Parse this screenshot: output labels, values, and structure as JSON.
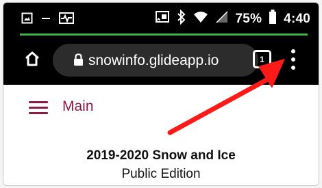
{
  "status_bar": {
    "battery_percent": "75%",
    "time": "4:40",
    "left_icons": [
      "gallery-icon",
      "minus-icon",
      "activity-icon"
    ],
    "right_icons": [
      "cast-icon",
      "bluetooth-icon",
      "wifi-icon",
      "signal-icon",
      "battery-icon"
    ]
  },
  "browser": {
    "url": "snowinfo.glideapp.io",
    "tab_count": "1"
  },
  "app": {
    "menu_title": "Main",
    "heading": "2019-2020 Snow and Ice",
    "subheading": "Public Edition"
  },
  "colors": {
    "accent": "#8e1b47",
    "toolbar": "#000000",
    "omnibox": "#2c2c2c",
    "progress": "#39b54a",
    "annotation": "#ff1a1a"
  }
}
